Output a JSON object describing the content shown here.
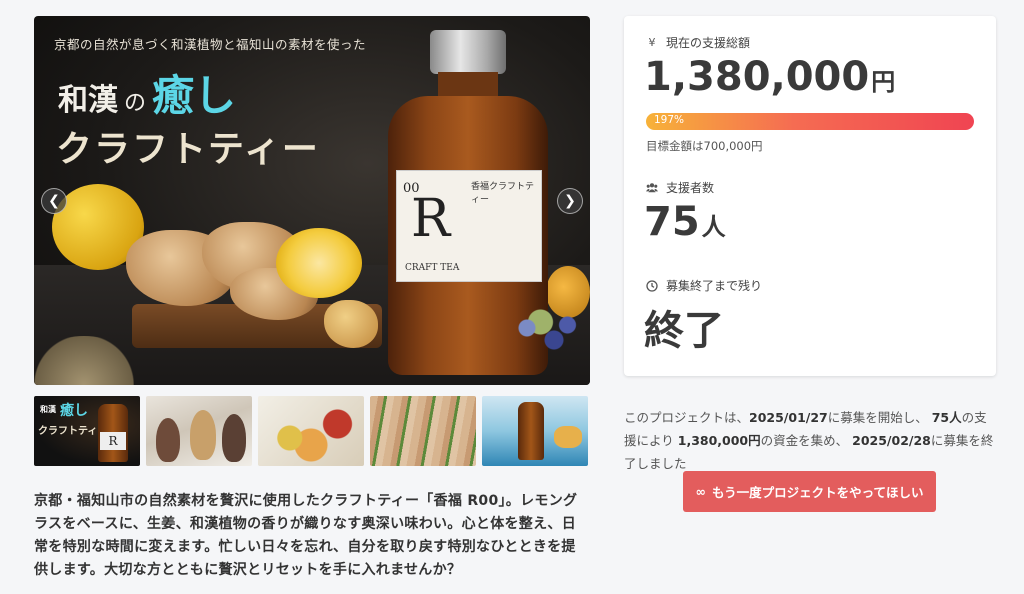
{
  "hero": {
    "subtitle": "京都の自然が息づく和漢植物と福知山の素材を使った",
    "title_part1": "和漢",
    "title_no": "の",
    "title_emphasis": "癒し",
    "title_line2": "クラフトティー",
    "bottle_label_prefix": "00",
    "bottle_label_letter": "R",
    "bottle_label_jp": "香福クラフトティー",
    "bottle_label_brand": "CRAFT TEA",
    "prev_icon": "chevron-left-icon",
    "next_icon": "chevron-right-icon"
  },
  "thumbnails": {
    "t1": {
      "caption_a": "和漢",
      "caption_emphasis": "癒し",
      "caption_b": "クラフトティー",
      "bottle_letter": "R"
    }
  },
  "description": "京都・福知山市の自然素材を贅沢に使用したクラフトティー「香福 R00」。レモングラスをベースに、生姜、和漢植物の香りが織りなす奥深い味わい。心と体を整え、日常を特別な時間に変えます。忙しい日々を忘れ、自分を取り戻す特別なひとときを提供します。大切な方とともに贅沢とリセットを手に入れませんか？",
  "stats": {
    "total_label": "現在の支援総額",
    "total_icon": "yen-icon",
    "total_value": "1,380,000",
    "total_unit": "円",
    "progress_percent": "197%",
    "progress_fraction": 1.0,
    "goal_text": "目標金額は700,000円",
    "backers_label": "支援者数",
    "backers_icon": "users-icon",
    "backers_value": "75",
    "backers_unit": "人",
    "remaining_label": "募集終了まで残り",
    "remaining_icon": "clock-icon",
    "remaining_value": "終了"
  },
  "summary": {
    "part1": "このプロジェクトは、",
    "start_date": "2025/01/27",
    "part2": "に募集を開始し、",
    "backers": "75人",
    "part3": "の支援により",
    "amount": "1,380,000円",
    "part4": "の資金を集め、",
    "end_date": "2025/02/28",
    "part5": "に募集を終了しました"
  },
  "cta": {
    "icon": "infinity-icon",
    "label": "もう一度プロジェクトをやってほしい"
  },
  "colors": {
    "accent": "#e35d5d",
    "progress_start": "#f7b239",
    "progress_end": "#f04452",
    "hero_emphasis": "#5cd6e6"
  }
}
